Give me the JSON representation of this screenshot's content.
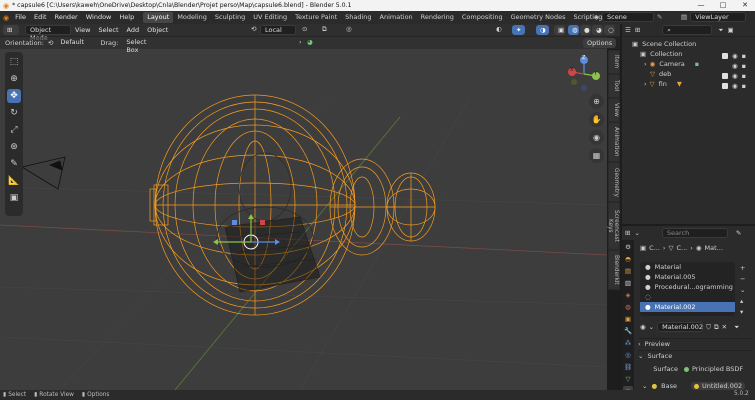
{
  "titlebar": {
    "title": "* capsule6 [C:\\Users\\kaweh\\OneDrive\\Desktop\\Cnla\\Blender\\Projet perso\\Map\\capsule6.blend] - Blender 5.0.1",
    "minimize": "—",
    "maximize": "□",
    "close": "✕"
  },
  "menu": [
    "File",
    "Edit",
    "Render",
    "Window",
    "Help"
  ],
  "workspaces": [
    "Layout",
    "Modeling",
    "Sculpting",
    "UV Editing",
    "Texture Paint",
    "Shading",
    "Animation",
    "Rendering",
    "Compositing",
    "Geometry Nodes",
    "Scripting"
  ],
  "workspace_add": "+",
  "scene": {
    "label": "Scene"
  },
  "viewlayer": {
    "label": "ViewLayer"
  },
  "viewport_header": {
    "mode": "Object Mode",
    "menus": [
      "View",
      "Select",
      "Add",
      "Object"
    ],
    "transform": "Local"
  },
  "viewport_header2": {
    "orientation_label": "Orientation:",
    "orientation_value": "Default",
    "drag_label": "Drag:",
    "drag_value": "Select Box",
    "options": "Options"
  },
  "tools": [
    "select-box",
    "cursor",
    "move",
    "rotate",
    "scale",
    "transform",
    "annotate",
    "measure",
    "add-cube"
  ],
  "gizmo": {
    "x": "X",
    "y": "Y",
    "z": "Z"
  },
  "n_tabs": [
    "Item",
    "Tool",
    "View",
    "Animation",
    "Geometry",
    "Screencast Keys",
    "Blenderkit"
  ],
  "outliner": {
    "search_placeholder": "",
    "items": [
      {
        "label": "Scene Collection",
        "indent": 0,
        "icon": "▣"
      },
      {
        "label": "Collection",
        "indent": 1,
        "icon": "▣"
      },
      {
        "label": "Camera",
        "indent": 2,
        "icon": "◉"
      },
      {
        "label": "deb",
        "indent": 2,
        "icon": "▽"
      },
      {
        "label": "fin",
        "indent": 2,
        "icon": "▽"
      }
    ]
  },
  "properties": {
    "search_placeholder": "Search",
    "breadcrumb": [
      "C...",
      "C...",
      "Mat..."
    ],
    "materials": [
      "Material",
      "Material.005",
      "Procedural...ogramming",
      "",
      "Material.002"
    ],
    "selected_material": "Material.002",
    "active_material_field": "Material.002",
    "panel_preview": "Preview",
    "panel_surface": "Surface",
    "surface_label": "Surface",
    "surface_value": "Principled BSDF",
    "base_label": "Base",
    "base_value": "Untitled.002"
  },
  "statusbar": {
    "select": "Select",
    "rotate": "Rotate View",
    "options": "Options",
    "version": "5.0.2"
  },
  "colors": {
    "accent": "#4772b3",
    "wire": "#f59b21",
    "viewport_bg": "#3d3d3d"
  }
}
